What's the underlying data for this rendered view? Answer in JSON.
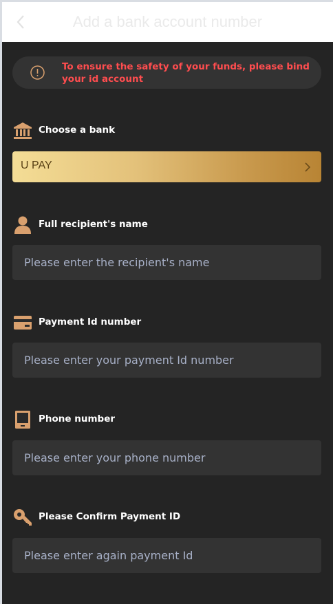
{
  "header": {
    "title": "Add a bank account number",
    "back_icon": "chevron-left-icon"
  },
  "notice": {
    "icon": "alert-circle-icon",
    "text": "To ensure the safety of your funds, please bind your id account",
    "color": "#ff4d4f"
  },
  "bank": {
    "label": "Choose a bank",
    "icon": "bank-icon",
    "selected": "U PAY",
    "chevron_icon": "chevron-right-icon"
  },
  "fields": [
    {
      "label": "Full recipient's name",
      "icon": "user-icon",
      "placeholder": "Please enter the recipient's name",
      "value": ""
    },
    {
      "label": "Payment Id number",
      "icon": "card-icon",
      "placeholder": "Please enter your payment Id number",
      "value": ""
    },
    {
      "label": "Phone number",
      "icon": "phone-icon",
      "placeholder": "Please enter your phone number",
      "value": ""
    },
    {
      "label": "Please Confirm Payment ID",
      "icon": "key-icon",
      "placeholder": "Please enter again payment Id",
      "value": ""
    }
  ],
  "colors": {
    "background": "#242424",
    "field_background": "#333333",
    "accent_gold": "#c99a4e",
    "icon_color": "#d9a06e",
    "placeholder": "#a8b1c8"
  }
}
